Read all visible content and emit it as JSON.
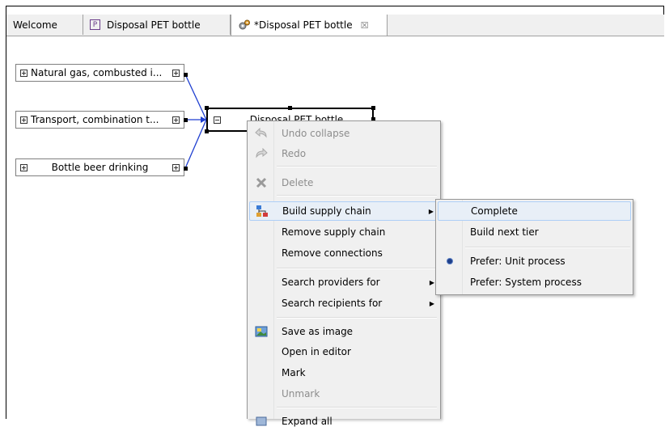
{
  "tabs": [
    {
      "label": "Welcome",
      "icon": "partial-tab"
    },
    {
      "label": "Disposal PET bottle",
      "icon": "process-icon-P"
    },
    {
      "label": "*Disposal PET bottle",
      "icon": "gear-icon",
      "close": "☒"
    }
  ],
  "nodes": {
    "natural_gas": "Natural gas, combusted i...",
    "transport": "Transport, combination t...",
    "bottle_beer": "Bottle beer drinking",
    "disposal": "Disposal PET bottle"
  },
  "context_menu": {
    "undo_collapse": "Undo collapse",
    "redo": "Redo",
    "delete": "Delete",
    "build_supply_chain": "Build supply chain",
    "remove_supply_chain": "Remove supply chain",
    "remove_connections": "Remove connections",
    "search_providers_for": "Search providers for",
    "search_recipients_for": "Search recipients for",
    "save_as_image": "Save as image",
    "open_in_editor": "Open in editor",
    "mark": "Mark",
    "unmark": "Unmark",
    "expand_all": "Expand all"
  },
  "submenu": {
    "complete": "Complete",
    "build_next_tier": "Build next tier",
    "prefer_unit_process": "Prefer: Unit process",
    "prefer_system_process": "Prefer: System process"
  },
  "colors": {
    "link": "#1f3fd0",
    "menu_bg": "#f0f0f0",
    "highlight": "#e8eff7"
  }
}
